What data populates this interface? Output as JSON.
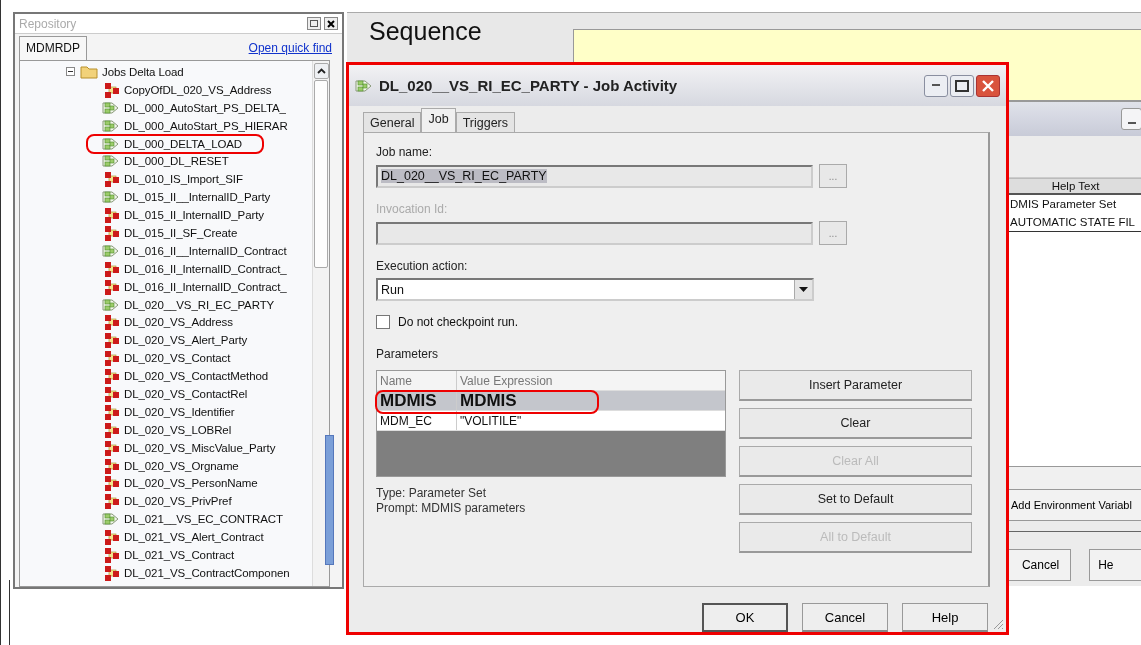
{
  "repository": {
    "title": "Repository",
    "tabs": [
      {
        "label": "MDMRDP",
        "selected": true
      }
    ],
    "link": "Open quick find",
    "tree": {
      "label": "Jobs Delta Load",
      "expanded": true,
      "children": [
        {
          "label": "CopyOfDL_020_VS_Address",
          "kind": "job",
          "highlighted": false
        },
        {
          "label": "DL_000_AutoStart_PS_DELTA_",
          "kind": "sequence",
          "highlighted": false
        },
        {
          "label": "DL_000_AutoStart_PS_HIERAR",
          "kind": "sequence",
          "highlighted": false
        },
        {
          "label": "DL_000_DELTA_LOAD",
          "kind": "sequence",
          "highlighted": true
        },
        {
          "label": "DL_000_DL_RESET",
          "kind": "sequence",
          "highlighted": false
        },
        {
          "label": "DL_010_IS_Import_SIF",
          "kind": "job",
          "highlighted": false
        },
        {
          "label": "DL_015_II__InternalID_Party",
          "kind": "sequence",
          "highlighted": false
        },
        {
          "label": "DL_015_II_InternalID_Party",
          "kind": "job",
          "highlighted": false
        },
        {
          "label": "DL_015_II_SF_Create",
          "kind": "job",
          "highlighted": false
        },
        {
          "label": "DL_016_II__InternalID_Contract",
          "kind": "sequence",
          "highlighted": false
        },
        {
          "label": "DL_016_II_InternalID_Contract_",
          "kind": "job",
          "highlighted": false
        },
        {
          "label": "DL_016_II_InternalID_Contract_",
          "kind": "job",
          "highlighted": false
        },
        {
          "label": "DL_020__VS_RI_EC_PARTY",
          "kind": "sequence",
          "highlighted": false
        },
        {
          "label": "DL_020_VS_Address",
          "kind": "job",
          "highlighted": false
        },
        {
          "label": "DL_020_VS_Alert_Party",
          "kind": "job",
          "highlighted": false
        },
        {
          "label": "DL_020_VS_Contact",
          "kind": "job",
          "highlighted": false
        },
        {
          "label": "DL_020_VS_ContactMethod",
          "kind": "job",
          "highlighted": false
        },
        {
          "label": "DL_020_VS_ContactRel",
          "kind": "job",
          "highlighted": false
        },
        {
          "label": "DL_020_VS_Identifier",
          "kind": "job",
          "highlighted": false
        },
        {
          "label": "DL_020_VS_LOBRel",
          "kind": "job",
          "highlighted": false
        },
        {
          "label": "DL_020_VS_MiscValue_Party",
          "kind": "job",
          "highlighted": false
        },
        {
          "label": "DL_020_VS_Orgname",
          "kind": "job",
          "highlighted": false
        },
        {
          "label": "DL_020_VS_PersonName",
          "kind": "job",
          "highlighted": false
        },
        {
          "label": "DL_020_VS_PrivPref",
          "kind": "job",
          "highlighted": false
        },
        {
          "label": "DL_021__VS_EC_CONTRACT",
          "kind": "sequence",
          "highlighted": false
        },
        {
          "label": "DL_021_VS_Alert_Contract",
          "kind": "job",
          "highlighted": false
        },
        {
          "label": "DL_021_VS_Contract",
          "kind": "job",
          "highlighted": false
        },
        {
          "label": "DL_021_VS_ContractComponen",
          "kind": "job",
          "highlighted": false
        }
      ]
    }
  },
  "canvas": {
    "title": "Sequence"
  },
  "background_window": {
    "column_header": "Help Text",
    "rows": [
      "DMIS Parameter Set",
      "AUTOMATIC STATE FIL"
    ],
    "buttons": [
      "Add Environment Variabl",
      "Cancel",
      "He"
    ]
  },
  "dialog": {
    "title": "DL_020__VS_RI_EC_PARTY - Job Activity",
    "highlighted": true,
    "tabs": [
      {
        "label": "General",
        "selected": false
      },
      {
        "label": "Job",
        "selected": true
      },
      {
        "label": "Triggers",
        "selected": false
      }
    ],
    "job_name": {
      "label": "Job name:",
      "value": "DL_020__VS_RI_EC_PARTY",
      "disabled": true,
      "browse": "..."
    },
    "invocation_id": {
      "label": "Invocation Id:",
      "disabled": true,
      "browse": "..."
    },
    "execution_action": {
      "label": "Execution action:",
      "value": "Run"
    },
    "checkpoint": {
      "label": "Do not checkpoint run.",
      "checked": false
    },
    "parameters": {
      "label": "Parameters",
      "columns": [
        "Name",
        "Value Expression"
      ],
      "rows": [
        {
          "name": "MDMIS",
          "value": "MDMIS",
          "selected": true,
          "highlighted": true
        },
        {
          "name": "MDM_EC",
          "value": "\"VOLITILE\"",
          "selected": false,
          "highlighted": false
        }
      ],
      "type": "Type: Parameter Set",
      "prompt": "Prompt: MDMIS parameters",
      "buttons": [
        {
          "label": "Insert Parameter",
          "disabled": false
        },
        {
          "label": "Clear",
          "disabled": false
        },
        {
          "label": "Clear All",
          "disabled": true
        },
        {
          "label": "Set to Default",
          "disabled": false
        },
        {
          "label": "All to Default",
          "disabled": true
        }
      ]
    },
    "footer_buttons": [
      "OK",
      "Cancel",
      "Help"
    ]
  }
}
